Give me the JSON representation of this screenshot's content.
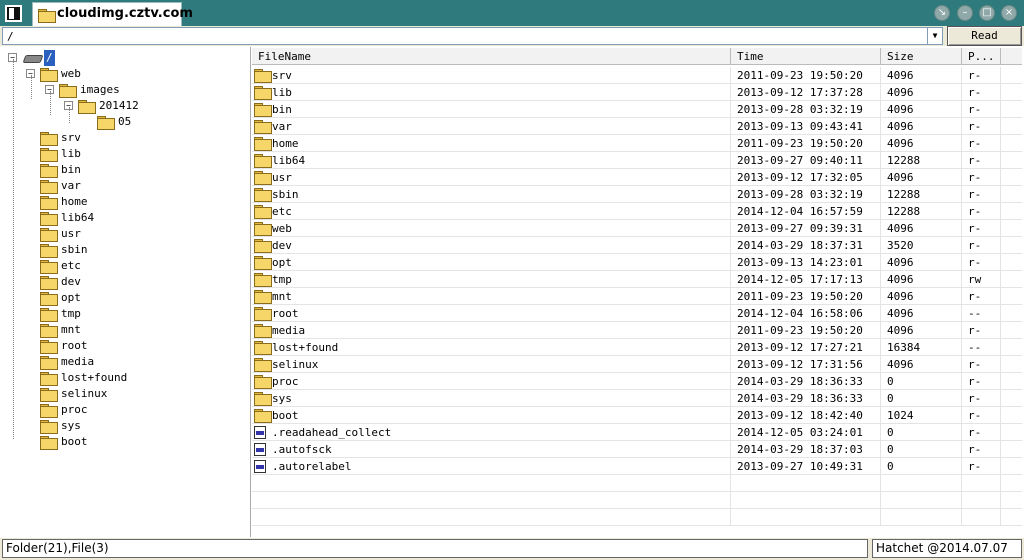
{
  "window": {
    "tab_title": "cloudimg.cztv.com",
    "controls": [
      "minimize-restore",
      "minimize",
      "maximize",
      "close"
    ]
  },
  "address": {
    "value": "/",
    "button_label": "Read"
  },
  "tree": {
    "root_label": "/",
    "nodes": [
      {
        "label": "web",
        "level": 1,
        "expanded": true
      },
      {
        "label": "images",
        "level": 2,
        "expanded": true
      },
      {
        "label": "201412",
        "level": 3,
        "expanded": true
      },
      {
        "label": "05",
        "level": 4,
        "expanded": false
      },
      {
        "label": "srv",
        "level": 1
      },
      {
        "label": "lib",
        "level": 1
      },
      {
        "label": "bin",
        "level": 1
      },
      {
        "label": "var",
        "level": 1
      },
      {
        "label": "home",
        "level": 1
      },
      {
        "label": "lib64",
        "level": 1
      },
      {
        "label": "usr",
        "level": 1
      },
      {
        "label": "sbin",
        "level": 1
      },
      {
        "label": "etc",
        "level": 1
      },
      {
        "label": "dev",
        "level": 1
      },
      {
        "label": "opt",
        "level": 1
      },
      {
        "label": "tmp",
        "level": 1
      },
      {
        "label": "mnt",
        "level": 1
      },
      {
        "label": "root",
        "level": 1
      },
      {
        "label": "media",
        "level": 1
      },
      {
        "label": "lost+found",
        "level": 1
      },
      {
        "label": "selinux",
        "level": 1
      },
      {
        "label": "proc",
        "level": 1
      },
      {
        "label": "sys",
        "level": 1
      },
      {
        "label": "boot",
        "level": 1
      }
    ]
  },
  "list": {
    "columns": [
      "FileName",
      "Time",
      "Size",
      "P..."
    ],
    "rows": [
      {
        "type": "folder",
        "name": "srv",
        "time": "2011-09-23 19:50:20",
        "size": "4096",
        "perm": "r-"
      },
      {
        "type": "folder",
        "name": "lib",
        "time": "2013-09-12 17:37:28",
        "size": "4096",
        "perm": "r-"
      },
      {
        "type": "folder",
        "name": "bin",
        "time": "2013-09-28 03:32:19",
        "size": "4096",
        "perm": "r-"
      },
      {
        "type": "folder",
        "name": "var",
        "time": "2013-09-13 09:43:41",
        "size": "4096",
        "perm": "r-"
      },
      {
        "type": "folder",
        "name": "home",
        "time": "2011-09-23 19:50:20",
        "size": "4096",
        "perm": "r-"
      },
      {
        "type": "folder",
        "name": "lib64",
        "time": "2013-09-27 09:40:11",
        "size": "12288",
        "perm": "r-"
      },
      {
        "type": "folder",
        "name": "usr",
        "time": "2013-09-12 17:32:05",
        "size": "4096",
        "perm": "r-"
      },
      {
        "type": "folder",
        "name": "sbin",
        "time": "2013-09-28 03:32:19",
        "size": "12288",
        "perm": "r-"
      },
      {
        "type": "folder",
        "name": "etc",
        "time": "2014-12-04 16:57:59",
        "size": "12288",
        "perm": "r-"
      },
      {
        "type": "folder",
        "name": "web",
        "time": "2013-09-27 09:39:31",
        "size": "4096",
        "perm": "r-"
      },
      {
        "type": "folder",
        "name": "dev",
        "time": "2014-03-29 18:37:31",
        "size": "3520",
        "perm": "r-"
      },
      {
        "type": "folder",
        "name": "opt",
        "time": "2013-09-13 14:23:01",
        "size": "4096",
        "perm": "r-"
      },
      {
        "type": "folder",
        "name": "tmp",
        "time": "2014-12-05 17:17:13",
        "size": "4096",
        "perm": "rw"
      },
      {
        "type": "folder",
        "name": "mnt",
        "time": "2011-09-23 19:50:20",
        "size": "4096",
        "perm": "r-"
      },
      {
        "type": "folder",
        "name": "root",
        "time": "2014-12-04 16:58:06",
        "size": "4096",
        "perm": "--"
      },
      {
        "type": "folder",
        "name": "media",
        "time": "2011-09-23 19:50:20",
        "size": "4096",
        "perm": "r-"
      },
      {
        "type": "folder",
        "name": "lost+found",
        "time": "2013-09-12 17:27:21",
        "size": "16384",
        "perm": "--"
      },
      {
        "type": "folder",
        "name": "selinux",
        "time": "2013-09-12 17:31:56",
        "size": "4096",
        "perm": "r-"
      },
      {
        "type": "folder",
        "name": "proc",
        "time": "2014-03-29 18:36:33",
        "size": "0",
        "perm": "r-"
      },
      {
        "type": "folder",
        "name": "sys",
        "time": "2014-03-29 18:36:33",
        "size": "0",
        "perm": "r-"
      },
      {
        "type": "folder",
        "name": "boot",
        "time": "2013-09-12 18:42:40",
        "size": "1024",
        "perm": "r-"
      },
      {
        "type": "file",
        "name": ".readahead_collect",
        "time": "2014-12-05 03:24:01",
        "size": "0",
        "perm": "r-"
      },
      {
        "type": "file",
        "name": ".autofsck",
        "time": "2014-03-29 18:37:03",
        "size": "0",
        "perm": "r-"
      },
      {
        "type": "file",
        "name": ".autorelabel",
        "time": "2013-09-27 10:49:31",
        "size": "0",
        "perm": "r-"
      }
    ]
  },
  "status": {
    "left": "Folder(21),File(3)",
    "right": "Hatchet @2014.07.07"
  },
  "colors": {
    "titlebar": "#2f7a7c",
    "folder": "#f7d669",
    "chrome": "#ece9d8"
  }
}
